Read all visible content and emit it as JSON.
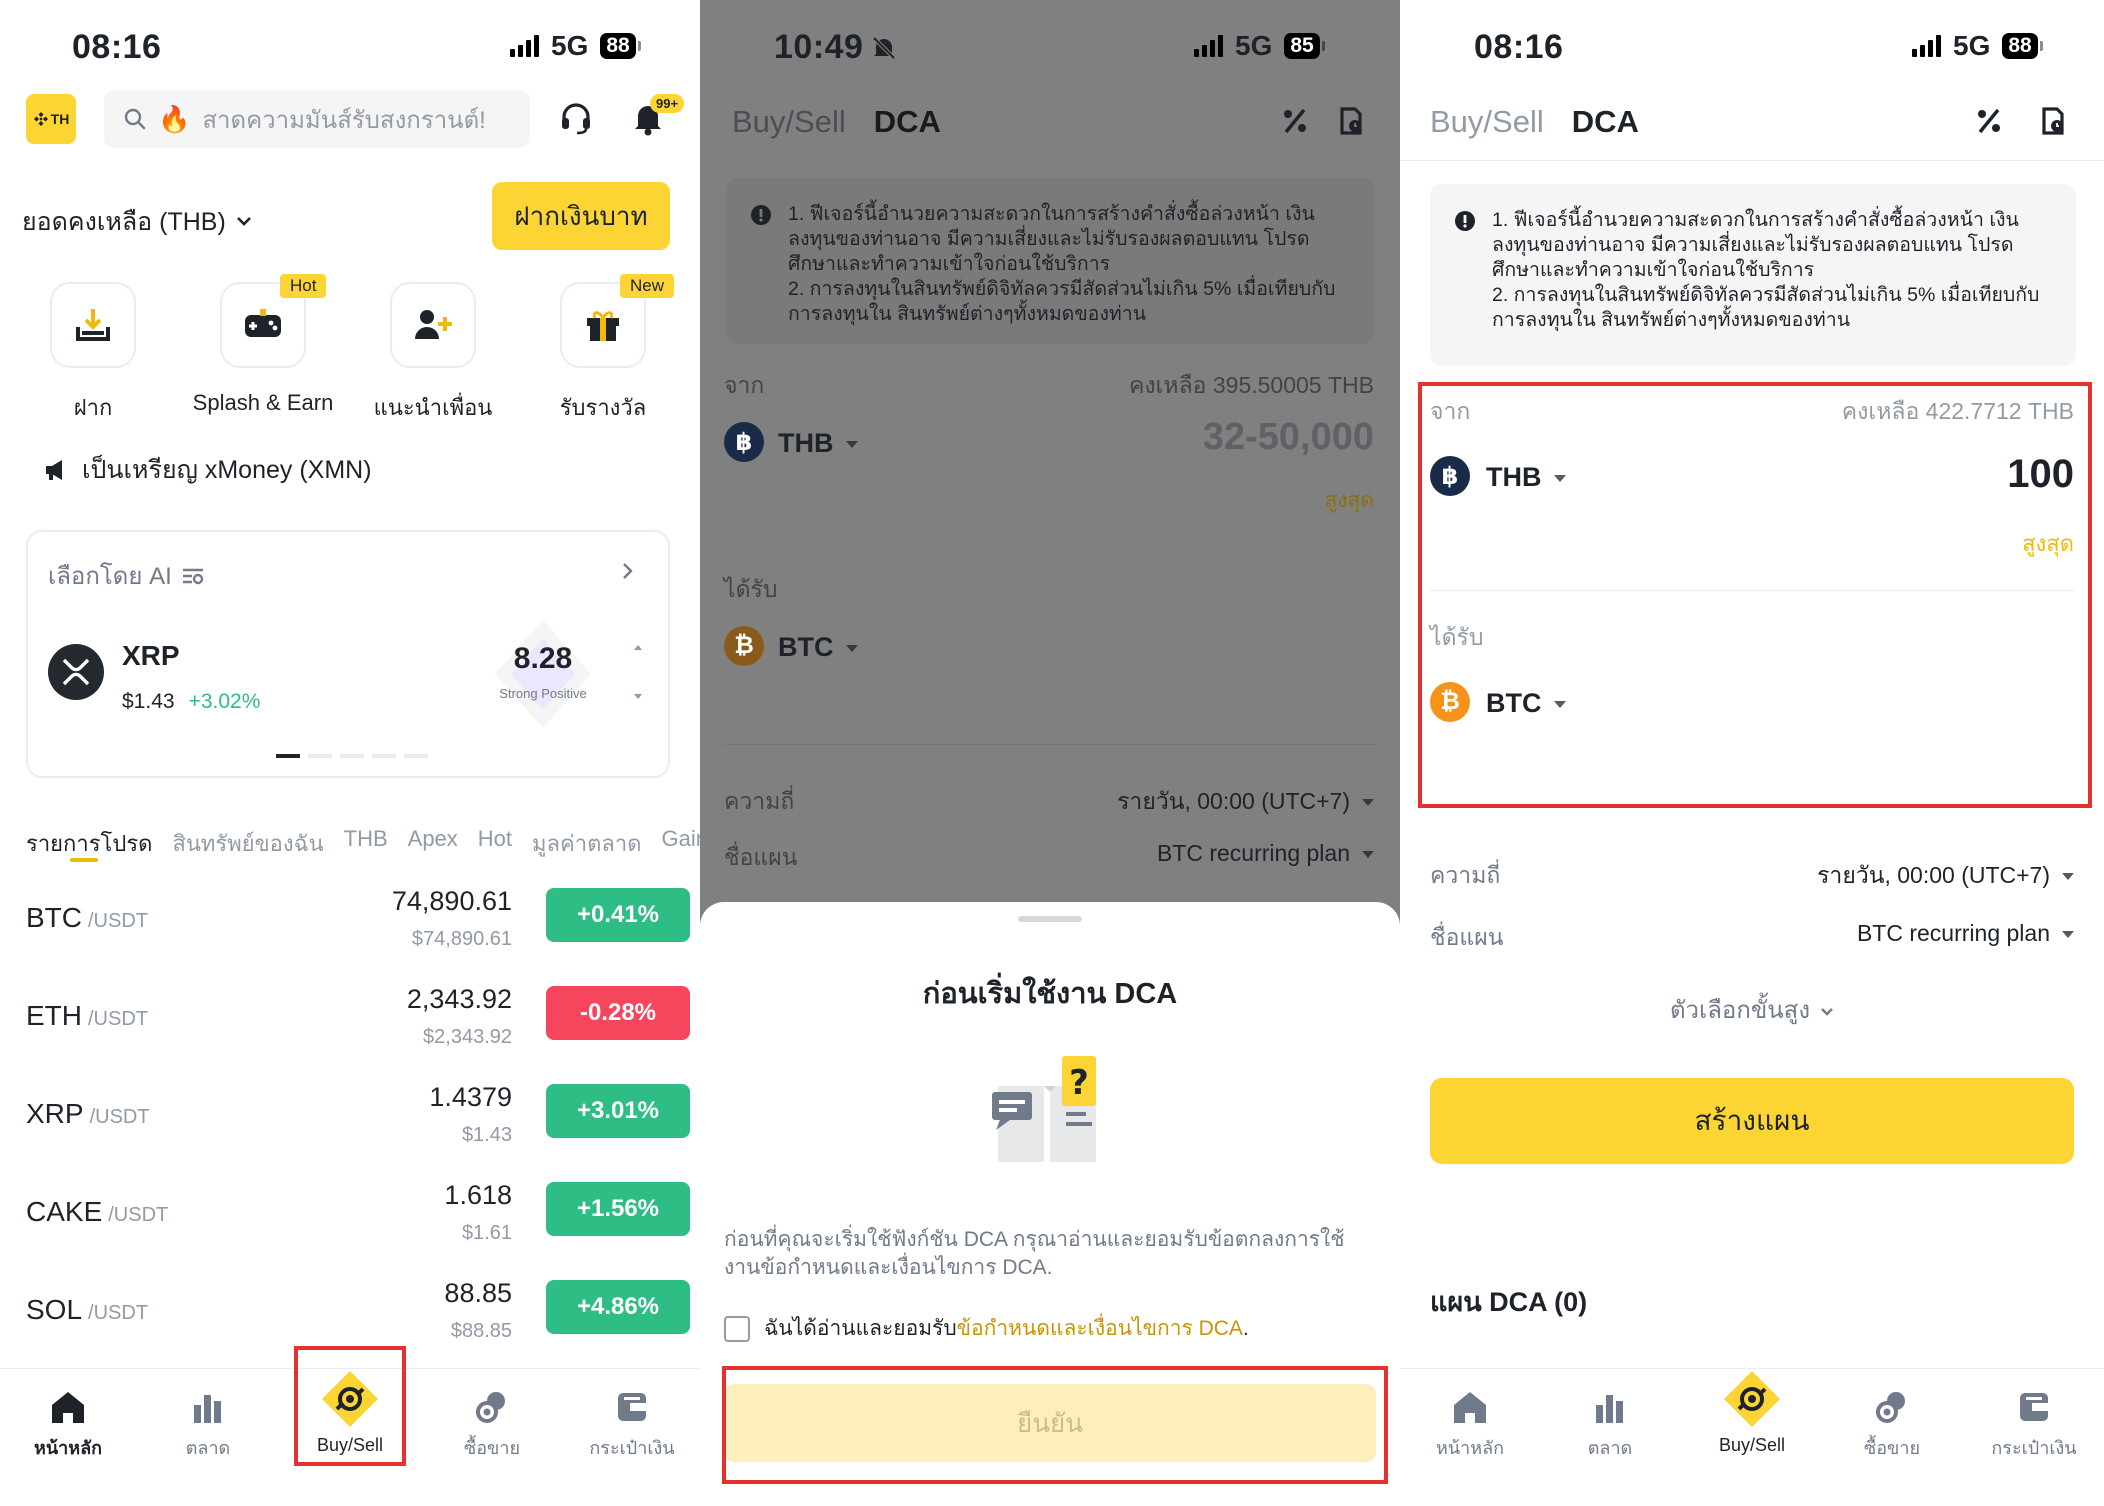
{
  "screen1": {
    "status": {
      "time": "08:16",
      "network": "5G",
      "battery": "88"
    },
    "region_badge": "TH",
    "search": {
      "placeholder": "สาดความมันส์รับสงกรานต์!"
    },
    "notif_badge": "99+",
    "balance_label": "ยอดคงเหลือ (THB)",
    "deposit_button": "ฝากเงินบาท",
    "quick_actions": [
      {
        "label": "ฝาก",
        "icon": "deposit-icon",
        "tag": ""
      },
      {
        "label": "Splash & Earn",
        "icon": "gamepad-icon",
        "tag": "Hot"
      },
      {
        "label": "แนะนำเพื่อน",
        "icon": "add-friend-icon",
        "tag": ""
      },
      {
        "label": "รับรางวัล",
        "icon": "gift-icon",
        "tag": "New"
      }
    ],
    "announcement": "เป็นเหรียญ xMoney (XMN)",
    "ai_card": {
      "title": "เลือกโดย AI",
      "coin": "XRP",
      "price": "$1.43",
      "change": "+3.02%",
      "score": "8.28",
      "score_label": "Strong Positive"
    },
    "category_tabs": [
      "รายการโปรด",
      "สินทรัพย์ของฉัน",
      "THB",
      "Apex",
      "Hot",
      "มูลค่าตลาด",
      "Gainers"
    ],
    "markets": [
      {
        "base": "BTC",
        "quote": "/USDT",
        "price": "74,890.61",
        "usd": "$74,890.61",
        "change": "+0.41%",
        "positive": true
      },
      {
        "base": "ETH",
        "quote": "/USDT",
        "price": "2,343.92",
        "usd": "$2,343.92",
        "change": "-0.28%",
        "positive": false
      },
      {
        "base": "XRP",
        "quote": "/USDT",
        "price": "1.4379",
        "usd": "$1.43",
        "change": "+3.01%",
        "positive": true
      },
      {
        "base": "CAKE",
        "quote": "/USDT",
        "price": "1.618",
        "usd": "$1.61",
        "change": "+1.56%",
        "positive": true
      },
      {
        "base": "SOL",
        "quote": "/USDT",
        "price": "88.85",
        "usd": "$88.85",
        "change": "+4.86%",
        "positive": true
      }
    ],
    "nav": [
      "หน้าหลัก",
      "ตลาด",
      "Buy/Sell",
      "ซื้อขาย",
      "กระเป๋าเงิน"
    ]
  },
  "screen2": {
    "status": {
      "time": "10:49",
      "network": "5G",
      "battery": "85"
    },
    "tabs": [
      "Buy/Sell",
      "DCA"
    ],
    "notice": "1. ฟีเจอร์นี้อำนวยความสะดวกในการสร้างคำสั่งซื้อล่วงหน้า เงินลงทุนของท่านอาจ มีความเสี่ยงและไม่รับรองผลตอบแทน โปรดศึกษาและทำความเข้าใจก่อนใช้บริการ\n2. การลงทุนในสินทรัพย์ดิจิทัลควรมีสัดส่วนไม่เกิน 5% เมื่อเทียบกับการลงทุนใน สินทรัพย์ต่างๆทั้งหมดของท่าน",
    "from_label": "จาก",
    "balance": "คงเหลือ 395.50005 THB",
    "from_coin": "THB",
    "amount_placeholder": "32-50,000",
    "max_label": "สูงสุด",
    "to_label": "ได้รับ",
    "to_coin": "BTC",
    "freq_label": "ความถี่",
    "freq_value": "รายวัน, 00:00 (UTC+7)",
    "plan_label": "ชื่อแผน",
    "plan_value": "BTC recurring plan",
    "sheet": {
      "title": "ก่อนเริ่มใช้งาน DCA",
      "body": "ก่อนที่คุณจะเริ่มใช้ฟังก์ชัน DCA กรุณาอ่านและยอมรับข้อตกลงการใช้งานข้อกำหนดและเงื่อนไขการ DCA.",
      "checkbox_text": "ฉันได้อ่านและยอมรับ",
      "checkbox_link": "ข้อกำหนดและเงื่อนไขการ DCA",
      "checkbox_end": ".",
      "confirm_button": "ยืนยัน"
    },
    "colors": {
      "overlay": "#808080",
      "accent": "#fcd535"
    }
  },
  "screen3": {
    "status": {
      "time": "08:16",
      "network": "5G",
      "battery": "88"
    },
    "tabs": [
      "Buy/Sell",
      "DCA"
    ],
    "notice": "1. ฟีเจอร์นี้อำนวยความสะดวกในการสร้างคำสั่งซื้อล่วงหน้า เงินลงทุนของท่านอาจ มีความเสี่ยงและไม่รับรองผลตอบแทน โปรดศึกษาและทำความเข้าใจก่อนใช้บริการ\n2. การลงทุนในสินทรัพย์ดิจิทัลควรมีสัดส่วนไม่เกิน 5% เมื่อเทียบกับการลงทุนใน สินทรัพย์ต่างๆทั้งหมดของท่าน",
    "from_label": "จาก",
    "balance": "คงเหลือ 422.7712 THB",
    "from_coin": "THB",
    "amount": "100",
    "max_label": "สูงสุด",
    "to_label": "ได้รับ",
    "to_coin": "BTC",
    "freq_label": "ความถี่",
    "freq_value": "รายวัน, 00:00 (UTC+7)",
    "plan_label": "ชื่อแผน",
    "plan_value": "BTC recurring plan",
    "advanced": "ตัวเลือกขั้นสูง",
    "create_button": "สร้างแผน",
    "plans_title": "แผน DCA (0)",
    "nav": [
      "หน้าหลัก",
      "ตลาด",
      "Buy/Sell",
      "ซื้อขาย",
      "กระเป๋าเงิน"
    ]
  },
  "colors": {
    "brand_yellow": "#fcd535",
    "positive": "#2ebd85",
    "negative": "#f6465d",
    "highlight_box": "#e3312c",
    "btc": "#f7931a",
    "thb": "#1a2b4a"
  }
}
